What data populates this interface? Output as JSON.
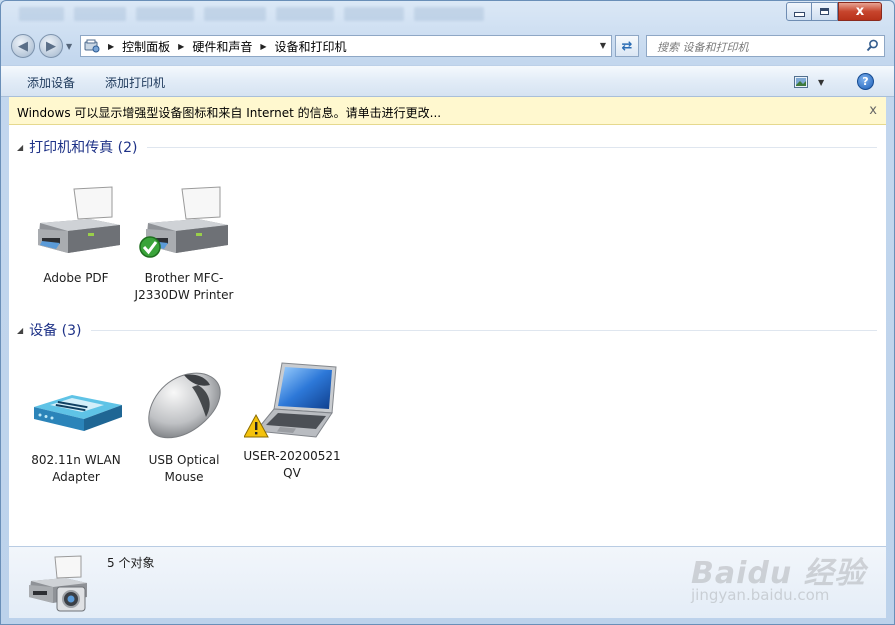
{
  "window": {
    "min_label": "",
    "max_label": "",
    "close_label": "x"
  },
  "nav": {
    "breadcrumbs": [
      "控制面板",
      "硬件和声音",
      "设备和打印机"
    ],
    "search_placeholder": "搜索 设备和打印机"
  },
  "commandbar": {
    "add_device": "添加设备",
    "add_printer": "添加打印机",
    "help": "?"
  },
  "infobar": {
    "message": "Windows 可以显示增强型设备图标和来自 Internet 的信息。请单击进行更改...",
    "close": "x"
  },
  "groups": [
    {
      "label": "打印机和传真 (2)",
      "items": [
        {
          "name": "Adobe PDF",
          "icon": "printer-icon",
          "default": false
        },
        {
          "name": "Brother MFC-J2330DW Printer",
          "icon": "printer-icon",
          "default": true
        }
      ]
    },
    {
      "label": "设备 (3)",
      "items": [
        {
          "name": "802.11n WLAN Adapter",
          "icon": "router-icon"
        },
        {
          "name": "USB Optical Mouse",
          "icon": "mouse-icon"
        },
        {
          "name": "USER-20200521 QV",
          "icon": "laptop-icon",
          "warning": true
        }
      ]
    }
  ],
  "details": {
    "count": "5 个对象"
  },
  "watermark": {
    "brand": "Baidu 经验",
    "url": "jingyan.baidu.com"
  },
  "colors": {
    "group_header": "#1e3287",
    "infobar_bg": "#fff8cf",
    "content_bg": "#ffffff"
  }
}
